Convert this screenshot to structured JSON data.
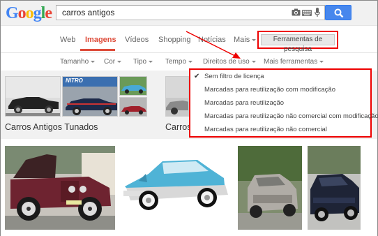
{
  "logo": {
    "letters": [
      "G",
      "o",
      "o",
      "g",
      "l",
      "e"
    ],
    "colors": [
      "#4285f4",
      "#ea4335",
      "#fbbc05",
      "#4285f4",
      "#34a853",
      "#ea4335"
    ]
  },
  "search": {
    "query": "carros antigos"
  },
  "tabs": [
    {
      "label": "Web",
      "active": false
    },
    {
      "label": "Imagens",
      "active": true
    },
    {
      "label": "Vídeos",
      "active": false
    },
    {
      "label": "Shopping",
      "active": false
    },
    {
      "label": "Notícias",
      "active": false
    },
    {
      "label": "Mais",
      "active": false
    }
  ],
  "tools_button": {
    "label": "Ferramentas de pesquisa"
  },
  "filters": [
    {
      "label": "Tamanho"
    },
    {
      "label": "Cor"
    },
    {
      "label": "Tipo"
    },
    {
      "label": "Tempo"
    },
    {
      "label": "Direitos de uso"
    },
    {
      "label": "Mais ferramentas"
    }
  ],
  "usage_rights_menu": {
    "items": [
      {
        "label": "Sem filtro de licença",
        "selected": true
      },
      {
        "label": "Marcadas para reutilização com modificação",
        "selected": false
      },
      {
        "label": "Marcadas para reutilização",
        "selected": false
      },
      {
        "label": "Marcadas para reutilização não comercial com modificação",
        "selected": false
      },
      {
        "label": "Marcadas para reutilização não comercial",
        "selected": false
      }
    ]
  },
  "related": [
    {
      "caption": "Carros Antigos Tunados",
      "thumb_text": "NITRO"
    },
    {
      "caption": "Carros"
    }
  ],
  "results": [
    {
      "alt": "red vintage car"
    },
    {
      "alt": "blue vintage car"
    },
    {
      "alt": "grey vintage car"
    },
    {
      "alt": "dark muscle car"
    }
  ],
  "colors": {
    "accent_red": "#dd4b39",
    "highlight_red": "#ee0000",
    "search_blue": "#4787ed"
  }
}
